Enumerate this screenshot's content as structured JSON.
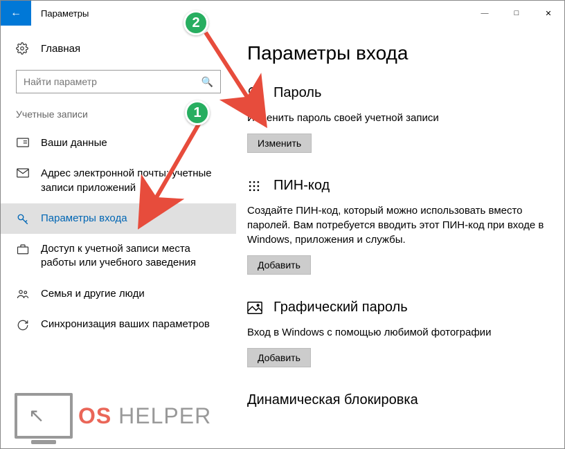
{
  "window": {
    "title": "Параметры"
  },
  "sidebar": {
    "home": "Главная",
    "search_placeholder": "Найти параметр",
    "section_label": "Учетные записи",
    "items": [
      {
        "label": "Ваши данные"
      },
      {
        "label": "Адрес электронной почты; учетные записи приложений"
      },
      {
        "label": "Параметры входа"
      },
      {
        "label": "Доступ к учетной записи места работы или учебного заведения"
      },
      {
        "label": "Семья и другие люди"
      },
      {
        "label": "Синхронизация ваших параметров"
      }
    ]
  },
  "content": {
    "title": "Параметры входа",
    "password": {
      "heading": "Пароль",
      "desc": "Изменить пароль своей учетной записи",
      "button": "Изменить"
    },
    "pin": {
      "heading": "ПИН-код",
      "desc": "Создайте ПИН-код, который можно использовать вместо паролей. Вам потребуется вводить этот ПИН-код при входе в Windows, приложения и службы.",
      "button": "Добавить"
    },
    "picture": {
      "heading": "Графический пароль",
      "desc": "Вход в Windows с помощью любимой фотографии",
      "button": "Добавить"
    },
    "dynamic": {
      "heading": "Динамическая блокировка"
    }
  },
  "annotations": {
    "badge1": "1",
    "badge2": "2"
  },
  "watermark": {
    "os": "OS",
    "helper": " HELPER"
  }
}
